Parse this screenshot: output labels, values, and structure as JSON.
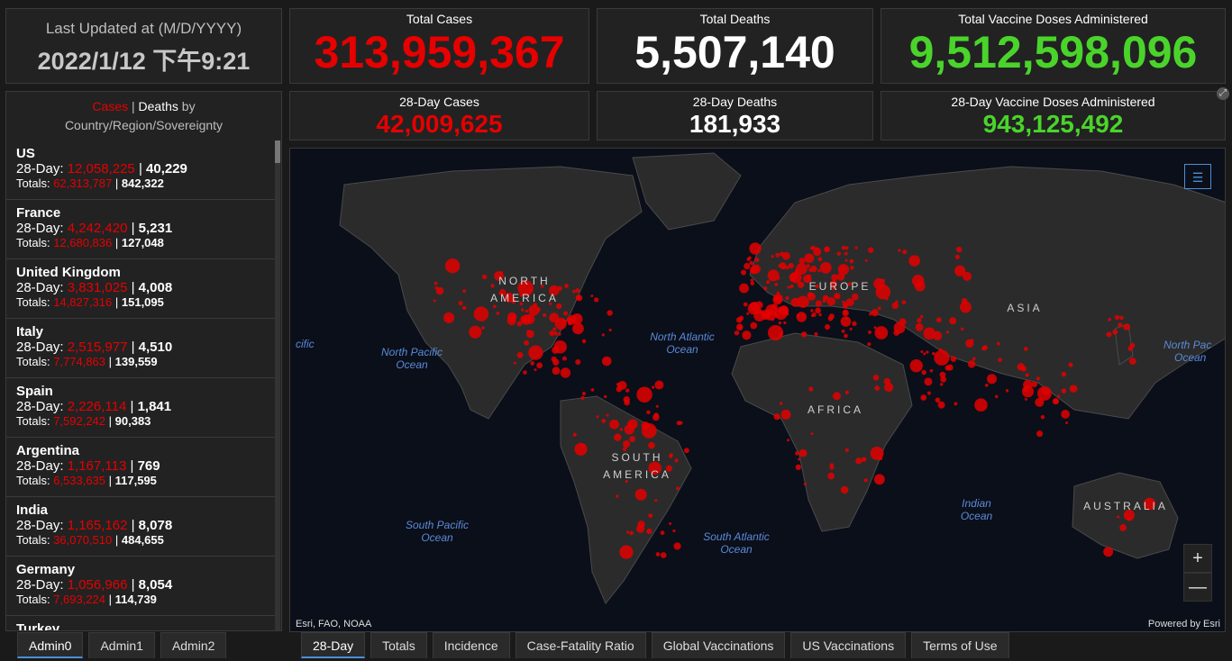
{
  "updated": {
    "label": "Last Updated at (M/D/YYYY)",
    "value": "2022/1/12 下午9:21"
  },
  "totals": {
    "cases_label": "Total Cases",
    "cases": "313,959,367",
    "deaths_label": "Total Deaths",
    "deaths": "5,507,140",
    "vaccine_label": "Total Vaccine Doses Administered",
    "vaccine": "9,512,598,096"
  },
  "day28": {
    "cases_label": "28-Day Cases",
    "cases": "42,009,625",
    "deaths_label": "28-Day Deaths",
    "deaths": "181,933",
    "vaccine_label": "28-Day Vaccine Doses Administered",
    "vaccine": "943,125,492"
  },
  "list_header": {
    "cases": "Cases",
    "sep": " | ",
    "deaths": "Deaths",
    "by": " by",
    "line2": "Country/Region/Sovereignty"
  },
  "list_labels": {
    "day28": "28-Day: ",
    "totals": "Totals: ",
    "sep": " | "
  },
  "countries": [
    {
      "name": "US",
      "c28": "12,058,225",
      "d28": "40,229",
      "ct": "62,313,787",
      "dt": "842,322"
    },
    {
      "name": "France",
      "c28": "4,242,420",
      "d28": "5,231",
      "ct": "12,680,836",
      "dt": "127,048"
    },
    {
      "name": "United Kingdom",
      "c28": "3,831,025",
      "d28": "4,008",
      "ct": "14,827,316",
      "dt": "151,095"
    },
    {
      "name": "Italy",
      "c28": "2,515,977",
      "d28": "4,510",
      "ct": "7,774,863",
      "dt": "139,559"
    },
    {
      "name": "Spain",
      "c28": "2,226,114",
      "d28": "1,841",
      "ct": "7,592,242",
      "dt": "90,383"
    },
    {
      "name": "Argentina",
      "c28": "1,167,113",
      "d28": "769",
      "ct": "6,533,635",
      "dt": "117,595"
    },
    {
      "name": "India",
      "c28": "1,165,162",
      "d28": "8,078",
      "ct": "36,070,510",
      "dt": "484,655"
    },
    {
      "name": "Germany",
      "c28": "1,056,966",
      "d28": "8,054",
      "ct": "7,693,224",
      "dt": "114,739"
    },
    {
      "name": "Turkey",
      "c28": "",
      "d28": "",
      "ct": "",
      "dt": ""
    }
  ],
  "map": {
    "oceans": {
      "pacific_w": "cific",
      "north_pacific": [
        "North Pacific",
        "Ocean"
      ],
      "north_atlantic": [
        "North Atlantic",
        "Ocean"
      ],
      "north_pacific_e": [
        "North Pac",
        "Ocean"
      ],
      "south_pacific": [
        "South Pacific",
        "Ocean"
      ],
      "south_atlantic": [
        "South Atlantic",
        "Ocean"
      ],
      "indian": [
        "Indian",
        "Ocean"
      ]
    },
    "continents": {
      "north_america": [
        "NORTH",
        "AMERICA"
      ],
      "europe": "EUROPE",
      "asia": "ASIA",
      "africa": "AFRICA",
      "south_america": [
        "SOUTH",
        "AMERICA"
      ],
      "australia": "AUSTRALIA"
    },
    "attribution": "Esri, FAO, NOAA",
    "powered": "Powered by Esri",
    "zoom_in": "+",
    "zoom_out": "—",
    "legend_icon": "list-icon"
  },
  "left_tabs": [
    "Admin0",
    "Admin1",
    "Admin2"
  ],
  "right_tabs": [
    "28-Day",
    "Totals",
    "Incidence",
    "Case-Fatality Ratio",
    "Global Vaccinations",
    "US Vaccinations",
    "Terms of Use"
  ],
  "colors": {
    "cases": "#e60000",
    "vaccine": "#4ad42b",
    "accent": "#4a8fd8"
  }
}
